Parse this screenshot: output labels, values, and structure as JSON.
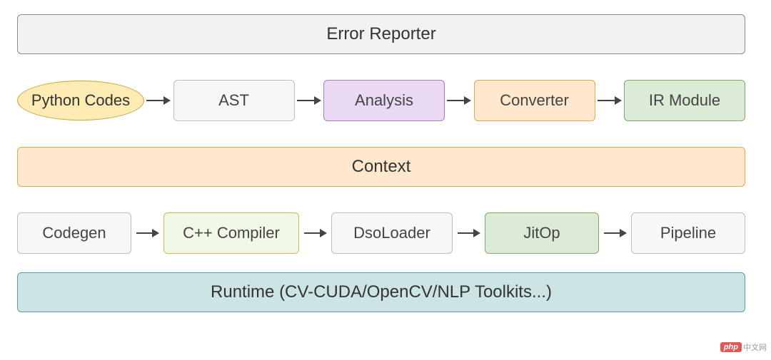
{
  "top": {
    "label": "Error Reporter"
  },
  "row1": {
    "start": "Python Codes",
    "b1": "AST",
    "b2": "Analysis",
    "b3": "Converter",
    "b4": "IR Module"
  },
  "context": {
    "label": "Context"
  },
  "row2": {
    "b1": "Codegen",
    "b2": "C++ Compiler",
    "b3": "DsoLoader",
    "b4": "JitOp",
    "b5": "Pipeline"
  },
  "runtime": {
    "label": "Runtime (CV-CUDA/OpenCV/NLP Toolkits...)"
  },
  "watermark": {
    "badge": "php",
    "text": "中文网"
  },
  "colors": {
    "grey": "#f2f2f2",
    "yellow": "#fdebb4",
    "purple": "#e9d9f2",
    "orange": "#fde7cd",
    "green": "#dcebd6",
    "lime": "#f1f9e6",
    "teal": "#cde4e4"
  }
}
